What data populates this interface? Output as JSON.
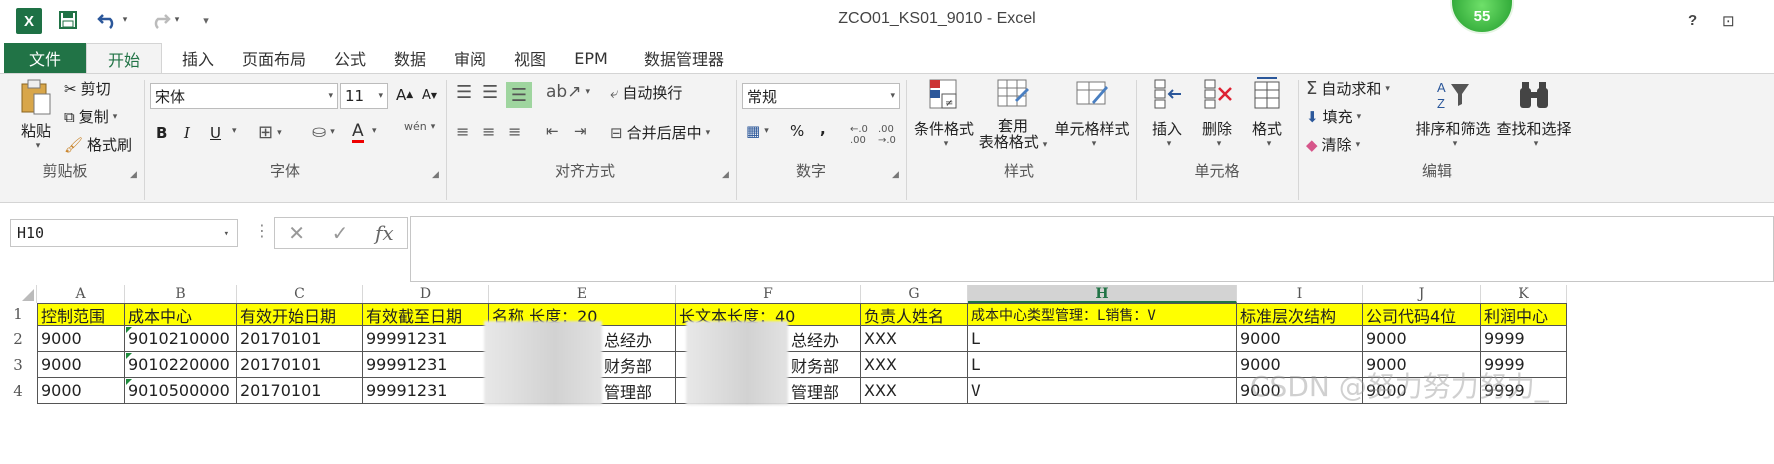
{
  "title_bar": {
    "excel_logo": "X",
    "window_title": "ZCO01_KS01_9010 - Excel",
    "badge": "55",
    "help": "?",
    "restore": "⊡"
  },
  "tabs": [
    "文件",
    "开始",
    "插入",
    "页面布局",
    "公式",
    "数据",
    "审阅",
    "视图",
    "EPM",
    "数据管理器"
  ],
  "ribbon": {
    "clipboard": {
      "paste": "粘贴",
      "cut": "剪切",
      "copy": "复制",
      "format_painter": "格式刷",
      "label": "剪贴板"
    },
    "font": {
      "name": "宋体",
      "size": "11",
      "bold": "B",
      "italic": "I",
      "underline": "U",
      "phonetic": "wén",
      "label": "字体"
    },
    "alignment": {
      "wrap_text": "自动换行",
      "merge_center": "合并后居中",
      "label": "对齐方式"
    },
    "number": {
      "format": "常规",
      "percent": "%",
      "comma": ",",
      "label": "数字"
    },
    "styles": {
      "conditional": "条件格式",
      "table_1": "套用",
      "table_2": "表格格式",
      "cell_styles": "单元格样式",
      "label": "样式"
    },
    "cells": {
      "insert": "插入",
      "delete": "删除",
      "format": "格式",
      "label": "单元格"
    },
    "editing": {
      "autosum": "自动求和",
      "fill": "填充",
      "clear": "清除",
      "sort_filter": "排序和筛选",
      "find_select": "查找和选择",
      "label": "编辑"
    }
  },
  "formula_bar": {
    "name_box": "H10",
    "formula": ""
  },
  "grid": {
    "columns": [
      "A",
      "B",
      "C",
      "D",
      "E",
      "F",
      "G",
      "H",
      "I",
      "J",
      "K"
    ],
    "selected_column": "H",
    "rows": [
      {
        "num": "1",
        "cells": [
          "控制范围",
          "成本中心",
          "有效开始日期",
          "有效截至日期",
          "名称  长度：20",
          "长文本长度：40",
          "负责人姓名",
          "成本中心类型管理：L销售：V",
          "标准层次结构",
          "公司代码4位",
          "利润中心"
        ]
      },
      {
        "num": "2",
        "cells": [
          "9000",
          "9010210000",
          "20170101",
          "99991231",
          "总经办",
          "总经办",
          "XXX",
          "L",
          "9000",
          "9000",
          "9999"
        ]
      },
      {
        "num": "3",
        "cells": [
          "9000",
          "9010220000",
          "20170101",
          "99991231",
          "财务部",
          "财务部",
          "XXX",
          "L",
          "9000",
          "9000",
          "9999"
        ]
      },
      {
        "num": "4",
        "cells": [
          "9000",
          "9010500000",
          "20170101",
          "99991231",
          "管理部",
          "管理部",
          "XXX",
          "V",
          "9000",
          "9000",
          "9999"
        ]
      }
    ],
    "watermark": "CSDN @努力努力努力_"
  }
}
